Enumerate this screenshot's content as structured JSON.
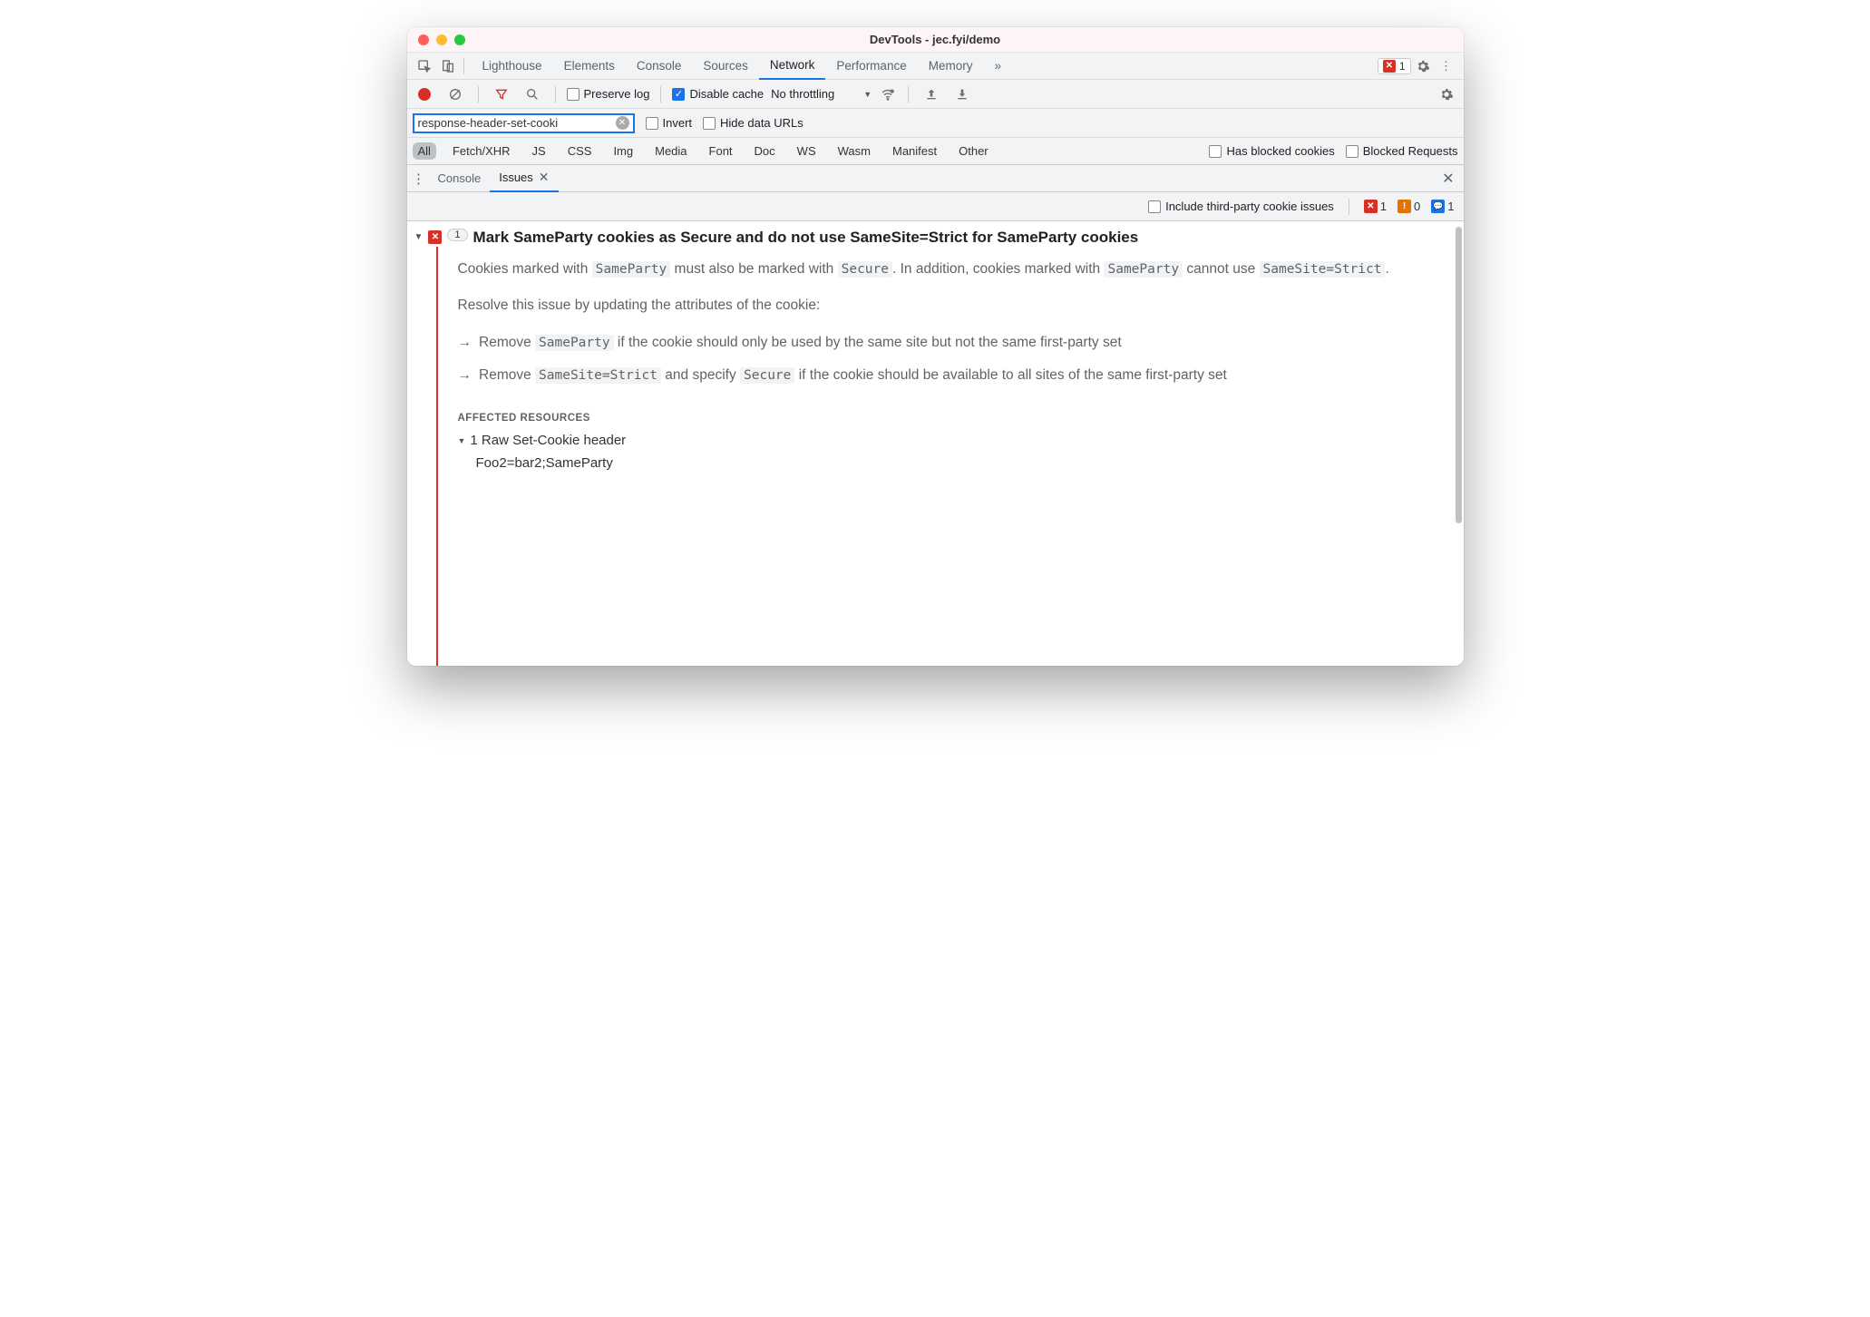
{
  "titlebar": {
    "title": "DevTools - jec.fyi/demo"
  },
  "tabs": {
    "items": [
      "Lighthouse",
      "Elements",
      "Console",
      "Sources",
      "Network",
      "Performance",
      "Memory"
    ],
    "active": "Network",
    "error_count": "1"
  },
  "network_options": {
    "preserve_log": "Preserve log",
    "disable_cache": "Disable cache",
    "throttling": "No throttling"
  },
  "filter": {
    "value": "response-header-set-cooki",
    "invert": "Invert",
    "hide_urls": "Hide data URLs"
  },
  "type_filters": {
    "items": [
      "All",
      "Fetch/XHR",
      "JS",
      "CSS",
      "Img",
      "Media",
      "Font",
      "Doc",
      "WS",
      "Wasm",
      "Manifest",
      "Other"
    ],
    "active": "All",
    "blocked_cookies": "Has blocked cookies",
    "blocked_requests": "Blocked Requests"
  },
  "drawer": {
    "tabs": [
      "Console",
      "Issues"
    ],
    "active": "Issues"
  },
  "issues_bar": {
    "third_party": "Include third-party cookie issues",
    "err": "1",
    "warn": "0",
    "info": "1"
  },
  "issue": {
    "count": "1",
    "title": "Mark SameParty cookies as Secure and do not use SameSite=Strict for SameParty cookies",
    "p1_pre": "Cookies marked with ",
    "p1_c1": "SameParty",
    "p1_mid": " must also be marked with ",
    "p1_c2": "Secure",
    "p1_mid2": ". In addition, cookies marked with ",
    "p1_c3": "SameParty",
    "p1_mid3": " cannot use ",
    "p1_c4": "SameSite=Strict",
    "p1_end": ".",
    "p2": "Resolve this issue by updating the attributes of the cookie:",
    "b1_pre": "Remove ",
    "b1_c": "SameParty",
    "b1_post": " if the cookie should only be used by the same site but not the same first-party set",
    "b2_pre": "Remove ",
    "b2_c1": "SameSite=Strict",
    "b2_mid": " and specify ",
    "b2_c2": "Secure",
    "b2_post": " if the cookie should be available to all sites of the same first-party set",
    "affected_heading": "AFFECTED RESOURCES",
    "aff_item": "1 Raw Set-Cookie header",
    "aff_value": "Foo2=bar2;SameParty"
  }
}
